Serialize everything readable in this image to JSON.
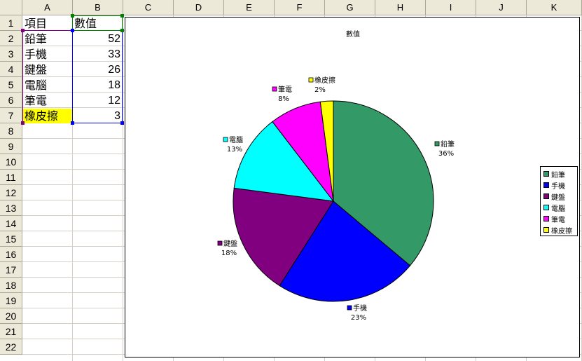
{
  "sheet": {
    "columns": [
      "A",
      "B",
      "C",
      "D",
      "E",
      "F",
      "G",
      "H",
      "I",
      "J",
      "K"
    ],
    "rows": [
      "1",
      "2",
      "3",
      "4",
      "5",
      "6",
      "7",
      "8",
      "9",
      "10",
      "11",
      "12",
      "13",
      "14",
      "15",
      "16",
      "17",
      "18",
      "19",
      "20",
      "21",
      "22"
    ],
    "header": {
      "item": "項目",
      "value": "數值"
    },
    "data": [
      {
        "item": "鉛筆",
        "value": "52"
      },
      {
        "item": "手機",
        "value": "33"
      },
      {
        "item": "鍵盤",
        "value": "26"
      },
      {
        "item": "電腦",
        "value": "18"
      },
      {
        "item": "筆電",
        "value": "12"
      },
      {
        "item": "橡皮擦",
        "value": "3"
      }
    ],
    "highlight_color": "#ffff00",
    "selection_color": "#0000ff"
  },
  "chart_data": {
    "type": "pie",
    "title": "數值",
    "categories": [
      "鉛筆",
      "手機",
      "鍵盤",
      "電腦",
      "筆電",
      "橡皮擦"
    ],
    "values": [
      52,
      33,
      26,
      18,
      12,
      3
    ],
    "percent_labels": [
      "36%",
      "23%",
      "18%",
      "13%",
      "8%",
      "2%"
    ],
    "colors": [
      "#339966",
      "#0000ff",
      "#800080",
      "#00ffff",
      "#ff00ff",
      "#ffff00"
    ],
    "legend_position": "right"
  }
}
